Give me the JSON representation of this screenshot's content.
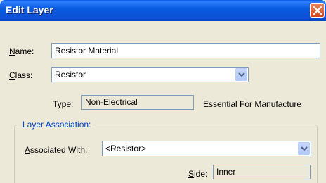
{
  "window": {
    "title": "Edit Layer"
  },
  "form": {
    "name_label_u": "N",
    "name_label_rest": "ame:",
    "name_value": "Resistor Material",
    "class_label_u": "C",
    "class_label_rest": "lass:",
    "class_value": "Resistor",
    "type_label": "Type:",
    "type_value": "Non-Electrical",
    "essential_text": "Essential For Manufacture"
  },
  "group": {
    "legend": "Layer Association:",
    "assoc_label_u": "A",
    "assoc_label_rest": "ssociated With:",
    "assoc_value": "<Resistor>",
    "side_label_u": "S",
    "side_label_rest": "ide:",
    "side_value": "Inner"
  }
}
